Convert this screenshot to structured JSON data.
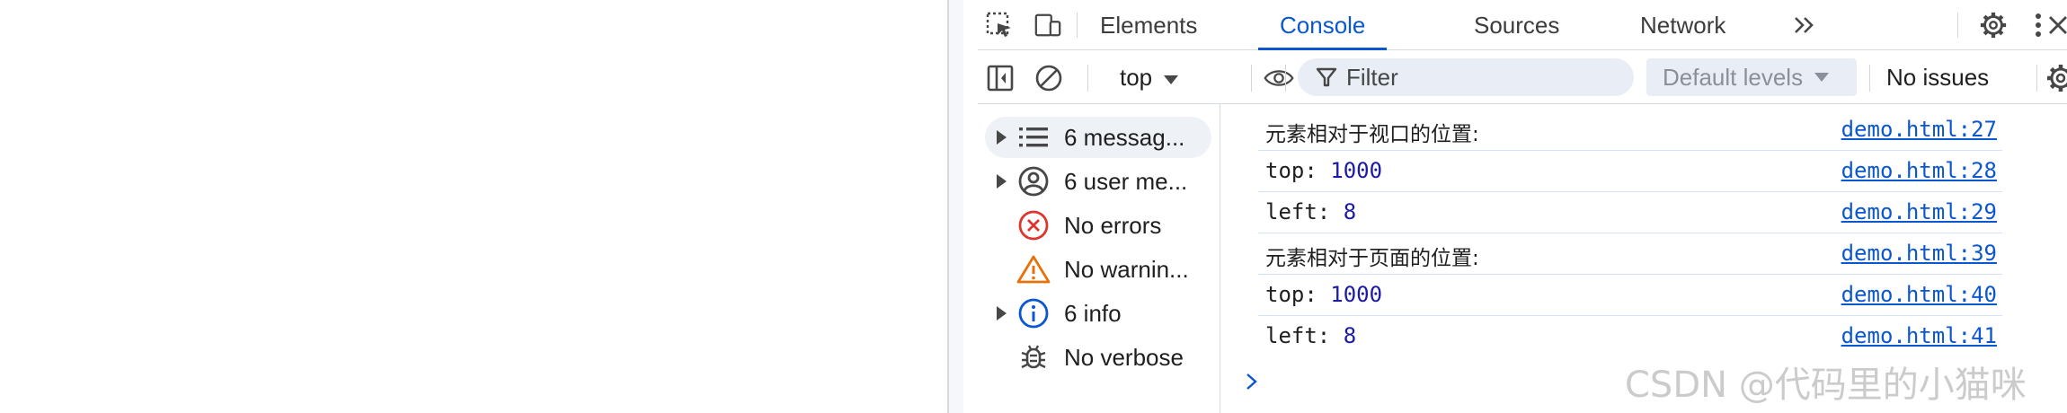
{
  "devtools": {
    "tabs": [
      {
        "label": "Elements",
        "active": false
      },
      {
        "label": "Console",
        "active": true
      },
      {
        "label": "Sources",
        "active": false
      },
      {
        "label": "Network",
        "active": false
      }
    ],
    "icons": {
      "inspect": "inspect-element-icon",
      "device": "device-toolbar-icon",
      "more_tabs": "more-tabs-icon",
      "settings": "gear-icon",
      "menu": "kebab-menu-icon",
      "close": "close-icon"
    }
  },
  "console_toolbar": {
    "context": "top",
    "filter_placeholder": "Filter",
    "levels": "Default levels",
    "issues": "No issues"
  },
  "sidebar": {
    "items": [
      {
        "label": "6 messag...",
        "icon": "list-icon",
        "expandable": true,
        "selected": true
      },
      {
        "label": "6 user me...",
        "icon": "user-icon",
        "expandable": true,
        "selected": false
      },
      {
        "label": "No errors",
        "icon": "error-icon",
        "expandable": false,
        "selected": false
      },
      {
        "label": "No warnin...",
        "icon": "warning-icon",
        "expandable": false,
        "selected": false
      },
      {
        "label": "6 info",
        "icon": "info-icon",
        "expandable": true,
        "selected": false
      },
      {
        "label": "No verbose",
        "icon": "bug-icon",
        "expandable": false,
        "selected": false
      }
    ]
  },
  "log": {
    "rows": [
      {
        "text": "元素相对于视口的位置:",
        "key": "",
        "value": "",
        "source": "demo.html:27"
      },
      {
        "text": "",
        "key": "top: ",
        "value": "1000",
        "source": "demo.html:28"
      },
      {
        "text": "",
        "key": "left: ",
        "value": "8",
        "source": "demo.html:29"
      },
      {
        "text": "元素相对于页面的位置:",
        "key": "",
        "value": "",
        "source": "demo.html:39"
      },
      {
        "text": "",
        "key": "top: ",
        "value": "1000",
        "source": "demo.html:40"
      },
      {
        "text": "",
        "key": "left: ",
        "value": "8",
        "source": "demo.html:41"
      }
    ]
  },
  "watermark": "CSDN @代码里的小猫咪",
  "colors": {
    "accent": "#0b57d0",
    "error": "#dc362e",
    "warning": "#e8710a",
    "info": "#0b57d0",
    "number": "#1a1aa6"
  }
}
